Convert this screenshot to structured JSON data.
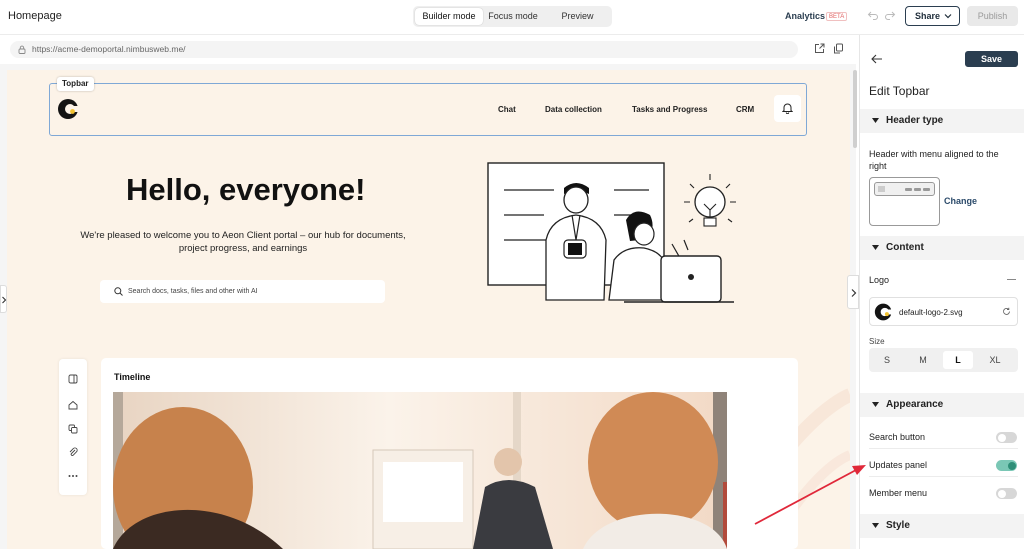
{
  "topbar": {
    "page_name": "Homepage",
    "modes": [
      "Builder mode",
      "Focus mode",
      "Preview"
    ],
    "active_mode": "Builder mode",
    "analytics": "Analytics",
    "beta": "BETA",
    "share": "Share",
    "publish": "Publish"
  },
  "browser": {
    "url": "https://acme-demoportal.nimbusweb.me/"
  },
  "site": {
    "topbar_tag": "Topbar",
    "nav": [
      "Chat",
      "Data collection",
      "Tasks and Progress",
      "CRM"
    ],
    "hero_title": "Hello, everyone!",
    "hero_subtitle": "We're pleased to welcome you to Aeon Client portal – our hub for documents, project progress, and earnings",
    "search_placeholder": "Search docs, tasks, files and other with AI",
    "timeline_title": "Timeline"
  },
  "panel": {
    "save": "Save",
    "title": "Edit Topbar",
    "sections": {
      "header_type": "Header type",
      "content": "Content",
      "appearance": "Appearance",
      "style": "Style"
    },
    "header_type_desc": "Header with menu aligned to the right",
    "change": "Change",
    "logo_label": "Logo",
    "logo_file": "default-logo-2.svg",
    "size_label": "Size",
    "sizes": [
      "S",
      "M",
      "L",
      "XL"
    ],
    "size_selected": "L",
    "toggles": [
      {
        "label": "Search button",
        "on": false
      },
      {
        "label": "Updates panel",
        "on": true
      },
      {
        "label": "Member menu",
        "on": false
      }
    ]
  },
  "colors": {
    "accent": "#2b3e50",
    "site_bg": "#fcf3e8",
    "selection": "#7fa8d6",
    "toggle_on": "#2f8f78",
    "annotation_arrow": "#e0283a"
  }
}
